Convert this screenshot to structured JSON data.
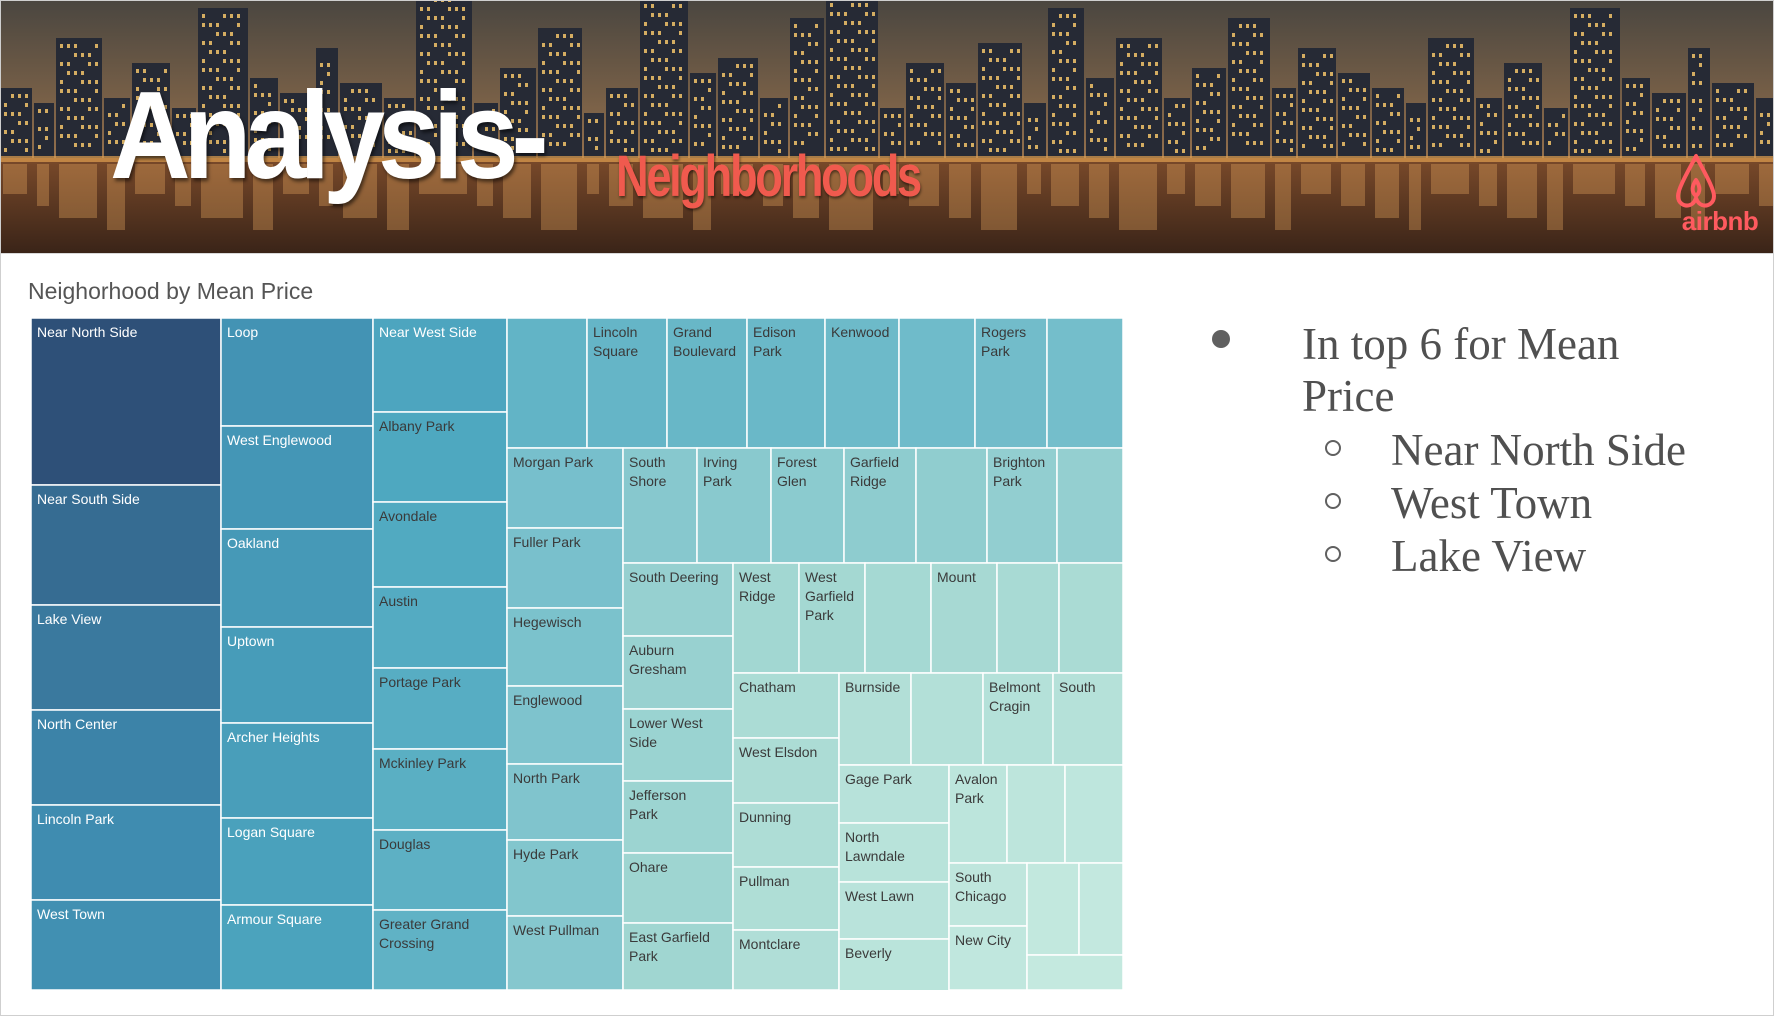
{
  "header": {
    "title": "Analysis-",
    "subtitle": "Neighborhoods",
    "brand": "airbnb"
  },
  "bullets": {
    "main": "In top 6 for Mean Price",
    "items": [
      "Near North Side",
      "West Town",
      "Lake View"
    ]
  },
  "chart_data": {
    "type": "treemap",
    "title": "Neighorhood by Mean Price",
    "measure": "Mean Price",
    "columns": [
      [
        "Near North Side",
        "Near South Side",
        "Lake View",
        "North Center",
        "Lincoln Park",
        "West Town"
      ],
      [
        "Loop",
        "West Englewood",
        "Oakland",
        "Uptown",
        "Archer Heights",
        "Logan Square",
        "Armour Square"
      ],
      [
        "Near West Side",
        "Albany Park",
        "Avondale",
        "Austin",
        "Portage Park",
        "Mckinley Park",
        "Douglas",
        "Greater Grand Crossing"
      ],
      [
        "",
        "Lincoln Square",
        "Grand Boulevard",
        "Edison Park",
        "Kenwood",
        "",
        "Rogers Park",
        ""
      ],
      [
        "Morgan Park",
        "Fuller Park",
        "Hegewisch",
        "Englewood",
        "North Park",
        "Hyde Park",
        "West Pullman"
      ],
      [
        "South Shore",
        "Irving Park",
        "Forest Glen",
        "Garfield Ridge",
        "",
        "Brighton Park",
        ""
      ],
      [
        "South Deering",
        "Auburn Gresham",
        "Lower West Side",
        "Jefferson Park",
        "Ohare",
        "East Garfield Park"
      ],
      [
        "West Ridge",
        "West Garfield Park",
        "",
        "Mount",
        "",
        ""
      ],
      [
        "Chatham",
        "West Elsdon",
        "Dunning",
        "Pullman",
        "Montclare"
      ],
      [
        "Burnside",
        "",
        "Belmont Cragin",
        "South"
      ],
      [
        "Gage Park",
        "North Lawndale",
        "West Lawn",
        "Beverly"
      ],
      [
        "Avalon Park",
        "",
        "",
        "South Chicago",
        "New City",
        "",
        "",
        ""
      ]
    ],
    "color_scale": {
      "high": "#2e5078",
      "mid": "#4aa3bd",
      "low": "#bfe6dc"
    }
  }
}
